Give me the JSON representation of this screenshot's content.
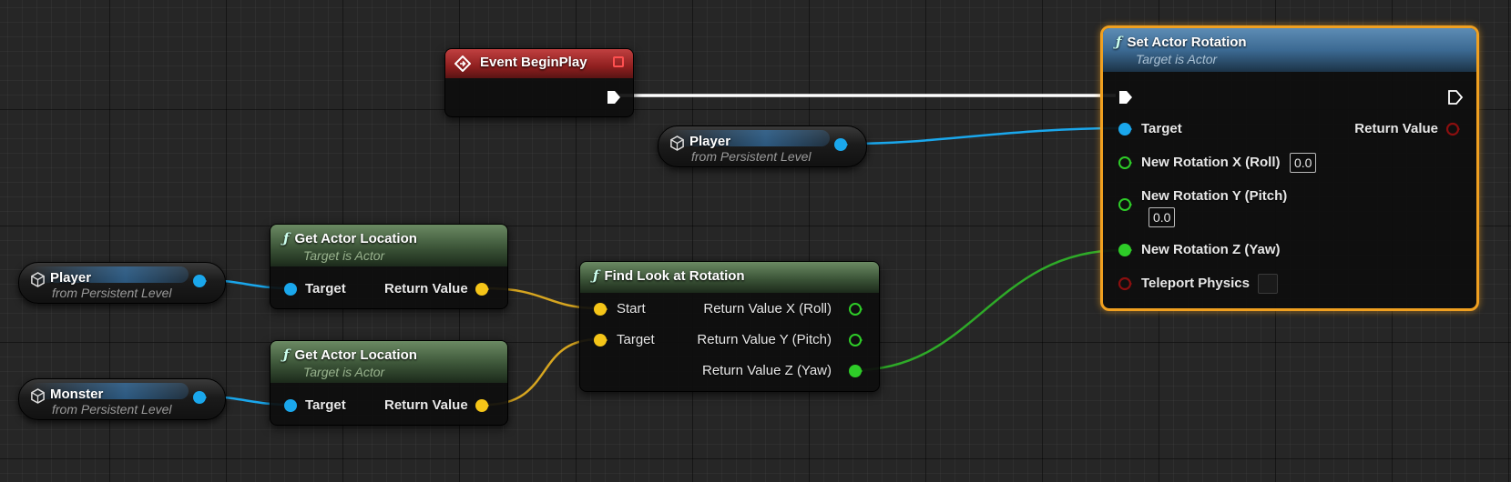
{
  "colors": {
    "exec": "#ffffff",
    "object": "#1aa7ec",
    "vector": "#f5c518",
    "float": "#2ecc28",
    "bool": "#8a0f0f",
    "selection": "#f0a020"
  },
  "nodes": {
    "event_begin_play": {
      "title": "Event BeginPlay",
      "icon": "event-diamond-icon"
    },
    "player_ref_top": {
      "name": "Player",
      "subtitle": "from Persistent Level",
      "icon": "actor-cube-icon"
    },
    "player_ref_left": {
      "name": "Player",
      "subtitle": "from Persistent Level",
      "icon": "actor-cube-icon"
    },
    "monster_ref": {
      "name": "Monster",
      "subtitle": "from Persistent Level",
      "icon": "actor-cube-icon"
    },
    "get_actor_location_1": {
      "title": "Get Actor Location",
      "subtitle": "Target is Actor",
      "pin_in": "Target",
      "pin_out": "Return Value"
    },
    "get_actor_location_2": {
      "title": "Get Actor Location",
      "subtitle": "Target is Actor",
      "pin_in": "Target",
      "pin_out": "Return Value"
    },
    "find_look_at_rotation": {
      "title": "Find Look at Rotation",
      "pin_start": "Start",
      "pin_target": "Target",
      "out_x": "Return Value X (Roll)",
      "out_y": "Return Value Y (Pitch)",
      "out_z": "Return Value Z (Yaw)"
    },
    "set_actor_rotation": {
      "title": "Set Actor Rotation",
      "subtitle": "Target is Actor",
      "pin_target": "Target",
      "pin_return": "Return Value",
      "pin_rot_x": "New Rotation X (Roll)",
      "rot_x_value": "0.0",
      "pin_rot_y": "New Rotation Y (Pitch)",
      "rot_y_value": "0.0",
      "pin_rot_z": "New Rotation Z (Yaw)",
      "pin_teleport": "Teleport Physics",
      "teleport_checked": false
    }
  }
}
